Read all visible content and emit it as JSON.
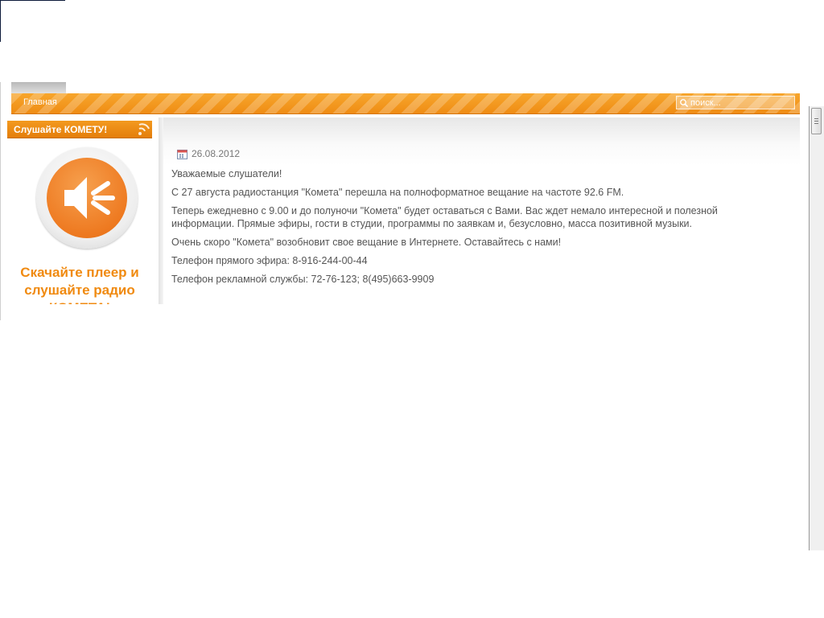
{
  "nav": {
    "home": "Главная",
    "search_placeholder": "поиск..."
  },
  "sidebar": {
    "header": "Слушайте КОМЕТУ!",
    "download_text": "Скачайте плеер и слушайте радио КОМЕТА!"
  },
  "article": {
    "date": "26.08.2012",
    "paragraphs": [
      "Уважаемые слушатели!",
      "С 27 августа радиостанция \"Комета\" перешла на полноформатное вещание на частоте 92.6 FM.",
      "Теперь ежедневно с 9.00 и до полуночи \"Комета\" будет оставаться с Вами. Вас ждет немало интересной и полезной информации. Прямые эфиры, гости в студии, программы по заявкам и, безусловно, масса позитивной музыки.",
      "Очень скоро \"Комета\" возобновит свое вещание в Интернете. Оставайтесь с нами!",
      "Телефон прямого эфира: 8-916-244-00-44",
      "Телефон рекламной службы: 72-76-123; 8(495)663-9909"
    ]
  },
  "colors": {
    "accent_orange": "#ef8c14",
    "text_gray": "#555555",
    "promo_orange": "#f08a10"
  },
  "icons": [
    "search-icon",
    "radio-waves-icon",
    "speaker-icon",
    "calendar-icon"
  ]
}
